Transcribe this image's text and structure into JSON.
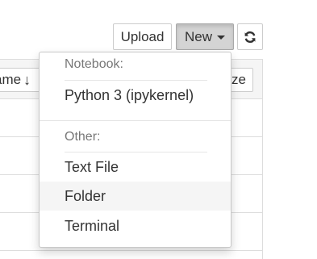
{
  "toolbar": {
    "upload_label": "Upload",
    "new_label": "New",
    "refresh_icon": "refresh-icon"
  },
  "list": {
    "sort_name_label": "ame",
    "sort_size_label": "ze"
  },
  "new_menu": {
    "notebook_header": "Notebook:",
    "notebook_items": [
      "Python 3 (ipykernel)"
    ],
    "other_header": "Other:",
    "other_items": [
      "Text File",
      "Folder",
      "Terminal"
    ],
    "highlighted_item": "Folder"
  },
  "colors": {
    "dropdown_border": "#c8c8c8",
    "highlight_bg": "#f5f5f5",
    "header_text": "#777777"
  }
}
